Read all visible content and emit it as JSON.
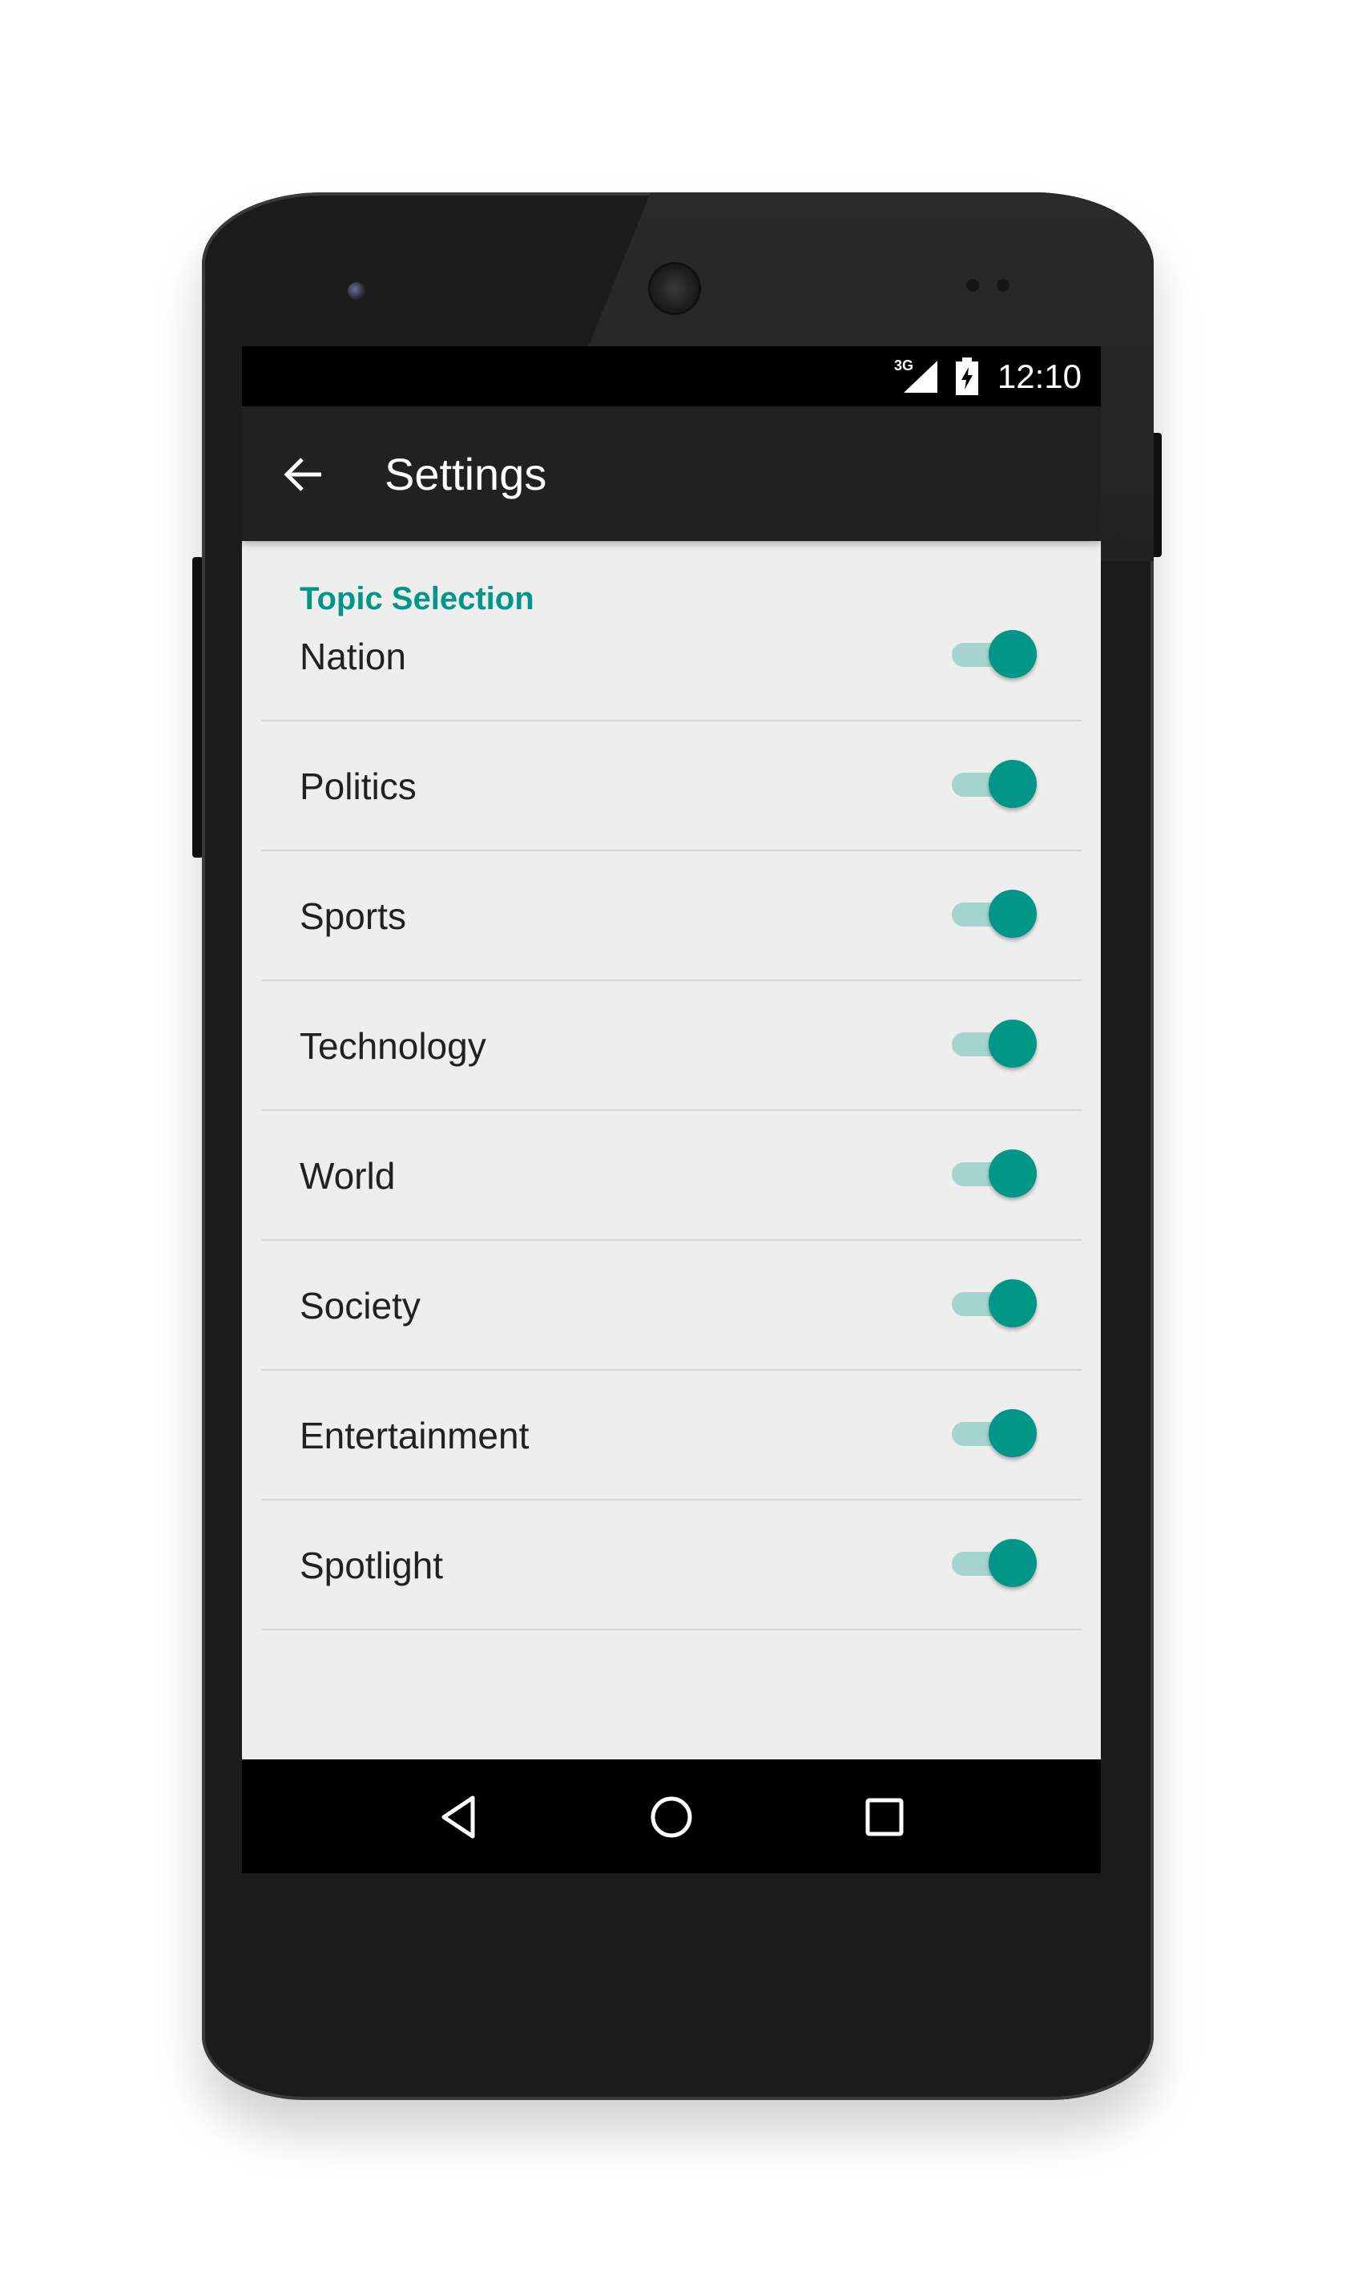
{
  "status_bar": {
    "network_type": "3G",
    "time": "12:10"
  },
  "app_bar": {
    "title": "Settings",
    "back_icon": "arrow-back-icon"
  },
  "settings": {
    "section_title": "Topic Selection",
    "items": [
      {
        "label": "Nation",
        "enabled": true
      },
      {
        "label": "Politics",
        "enabled": true
      },
      {
        "label": "Sports",
        "enabled": true
      },
      {
        "label": "Technology",
        "enabled": true
      },
      {
        "label": "World",
        "enabled": true
      },
      {
        "label": "Society",
        "enabled": true
      },
      {
        "label": "Entertainment",
        "enabled": true
      },
      {
        "label": "Spotlight",
        "enabled": true
      }
    ]
  },
  "nav_bar": {
    "back_icon": "triangle-back-icon",
    "home_icon": "circle-home-icon",
    "recents_icon": "square-recents-icon"
  },
  "colors": {
    "accent": "#009688",
    "track": "#a5d4cf",
    "app_bar": "#212121",
    "background": "#eeeeee"
  }
}
